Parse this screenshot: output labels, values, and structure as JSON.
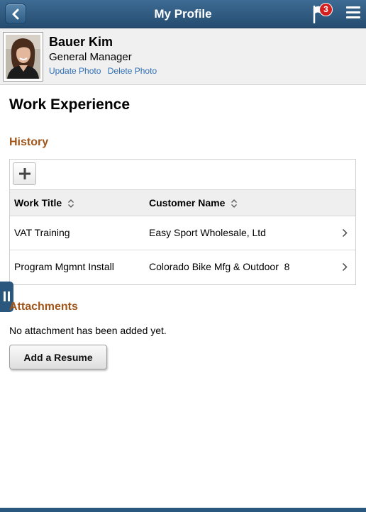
{
  "header": {
    "title": "My Profile",
    "back_icon": "chevron-left-icon",
    "notifications_icon": "flag-icon",
    "notification_count": "3",
    "menu_icon": "hamburger-menu-icon"
  },
  "profile": {
    "name": "Bauer Kim",
    "role": "General Manager",
    "update_photo_label": "Update Photo",
    "delete_photo_label": "Delete Photo"
  },
  "page": {
    "title": "Work Experience"
  },
  "history": {
    "title": "History",
    "add_icon": "plus-icon",
    "columns": {
      "work_title": "Work Title",
      "customer_name": "Customer Name"
    },
    "rows": [
      {
        "work_title": "VAT Training",
        "customer_name": "Easy Sport Wholesale, Ltd"
      },
      {
        "work_title": "Program Mgmnt Install",
        "customer_name": "Colorado Bike Mfg & Outdoor  8"
      }
    ]
  },
  "attachments": {
    "title": "Attachments",
    "empty_message": "No attachment has been added yet.",
    "add_resume_label": "Add a Resume"
  },
  "colors": {
    "header_bg": "#2d5a82",
    "section_title": "#a0561b",
    "link": "#2f6fb6",
    "badge": "#d21f1f"
  }
}
